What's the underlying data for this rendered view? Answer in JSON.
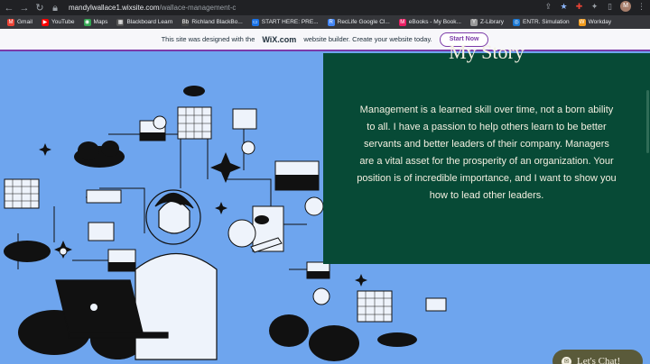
{
  "browser": {
    "url_domain": "mandylwallace1.wixsite.com",
    "url_path": "/wallace-management-c",
    "profile_initial": "M"
  },
  "bookmarks": [
    {
      "label": "Gmail",
      "icon": "gmail-icon",
      "color": "#ea4335",
      "glyph": "M"
    },
    {
      "label": "YouTube",
      "icon": "youtube-icon",
      "color": "#ff0000",
      "glyph": "▶"
    },
    {
      "label": "Maps",
      "icon": "maps-icon",
      "color": "#34a853",
      "glyph": "◉"
    },
    {
      "label": "Blackboard Learn",
      "icon": "blackboard-icon",
      "color": "#555555",
      "glyph": "▦"
    },
    {
      "label": "Richland BlackBo...",
      "icon": "richland-icon",
      "color": "#444444",
      "glyph": "Bb"
    },
    {
      "label": "START HERE: PRE...",
      "icon": "pearson-icon",
      "color": "#1a73e8",
      "glyph": "▭"
    },
    {
      "label": "RecLife Google Cl...",
      "icon": "reclife-icon",
      "color": "#4285f4",
      "glyph": "R"
    },
    {
      "label": "eBooks - My Book...",
      "icon": "ebooks-icon",
      "color": "#e91e63",
      "glyph": "M"
    },
    {
      "label": "Z-Library",
      "icon": "zlibrary-icon",
      "color": "#999999",
      "glyph": "Y"
    },
    {
      "label": "ENTR. Simulation",
      "icon": "entr-icon",
      "color": "#1976d2",
      "glyph": "◎"
    },
    {
      "label": "Workday",
      "icon": "workday-icon",
      "color": "#f29c1d",
      "glyph": "W"
    }
  ],
  "wix_banner": {
    "prefix": "This site was designed with the",
    "logo": "WiX.com",
    "suffix": "website builder. Create your website today.",
    "button": "Start Now"
  },
  "story": {
    "title": "My Story",
    "body": "Management is a learned skill over time, not a born ability to all. I have a passion to help others learn to be better servants and better leaders of their company. Managers are a vital asset for the prosperity of an organization. Your position is of incredible importance, and I want to show you how to lead other leaders."
  },
  "chat": {
    "label": "Let's Chat!"
  },
  "colors": {
    "illustration_bg": "#6ea5ee",
    "panel_bg": "#074a36",
    "panel_text": "#f3efe0",
    "wix_accent": "#7b3aa8"
  }
}
